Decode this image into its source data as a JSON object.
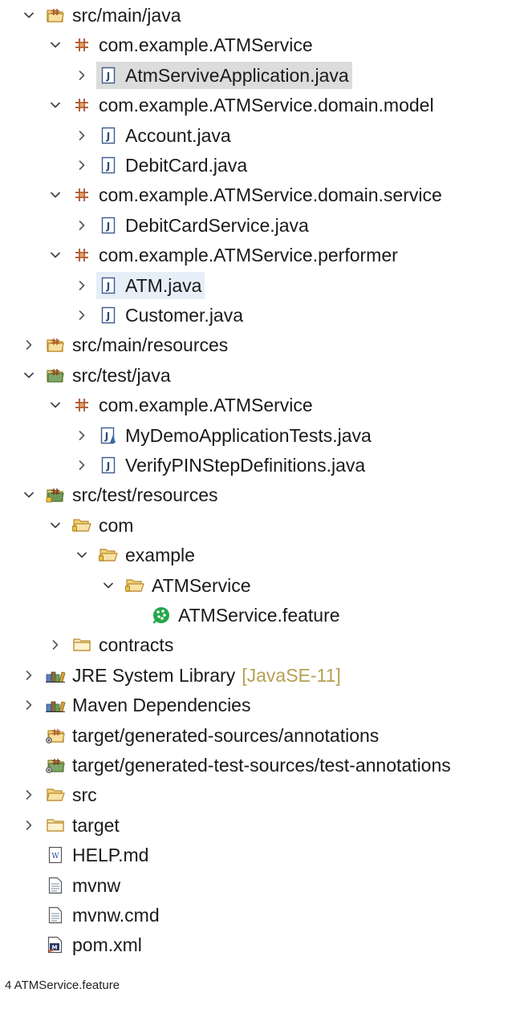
{
  "tree": [
    {
      "label": "src/main/java",
      "indent": 0,
      "chevron": "expanded",
      "icon": "source-folder-icon"
    },
    {
      "label": "com.example.ATMService",
      "indent": 1,
      "chevron": "expanded",
      "icon": "package-icon"
    },
    {
      "label": "AtmServiveApplication.java",
      "indent": 2,
      "chevron": "collapsed",
      "icon": "java-file-icon",
      "state": "selected"
    },
    {
      "label": "com.example.ATMService.domain.model",
      "indent": 1,
      "chevron": "expanded",
      "icon": "package-icon"
    },
    {
      "label": "Account.java",
      "indent": 2,
      "chevron": "collapsed",
      "icon": "java-file-icon"
    },
    {
      "label": "DebitCard.java",
      "indent": 2,
      "chevron": "collapsed",
      "icon": "java-file-icon"
    },
    {
      "label": "com.example.ATMService.domain.service",
      "indent": 1,
      "chevron": "expanded",
      "icon": "package-icon"
    },
    {
      "label": "DebitCardService.java",
      "indent": 2,
      "chevron": "collapsed",
      "icon": "java-file-icon"
    },
    {
      "label": "com.example.ATMService.performer",
      "indent": 1,
      "chevron": "expanded",
      "icon": "package-icon"
    },
    {
      "label": "ATM.java",
      "indent": 2,
      "chevron": "collapsed",
      "icon": "java-file-icon",
      "state": "hover"
    },
    {
      "label": "Customer.java",
      "indent": 2,
      "chevron": "collapsed",
      "icon": "java-file-icon"
    },
    {
      "label": "src/main/resources",
      "indent": 0,
      "chevron": "collapsed",
      "icon": "source-folder-icon"
    },
    {
      "label": "src/test/java",
      "indent": 0,
      "chevron": "expanded",
      "icon": "test-source-folder-icon"
    },
    {
      "label": "com.example.ATMService",
      "indent": 1,
      "chevron": "expanded",
      "icon": "package-icon"
    },
    {
      "label": "MyDemoApplicationTests.java",
      "indent": 2,
      "chevron": "collapsed",
      "icon": "java-test-file-icon"
    },
    {
      "label": "VerifyPINStepDefinitions.java",
      "indent": 2,
      "chevron": "collapsed",
      "icon": "java-file-icon"
    },
    {
      "label": "src/test/resources",
      "indent": 0,
      "chevron": "expanded",
      "icon": "test-resource-folder-icon"
    },
    {
      "label": "com",
      "indent": 1,
      "chevron": "expanded",
      "icon": "open-folder-icon"
    },
    {
      "label": "example",
      "indent": 2,
      "chevron": "expanded",
      "icon": "open-folder-icon"
    },
    {
      "label": "ATMService",
      "indent": 3,
      "chevron": "expanded",
      "icon": "open-folder-icon"
    },
    {
      "label": "ATMService.feature",
      "indent": 4,
      "chevron": "none",
      "icon": "cucumber-feature-icon"
    },
    {
      "label": "contracts",
      "indent": 1,
      "chevron": "collapsed",
      "icon": "closed-folder-icon"
    },
    {
      "label": "JRE System Library",
      "decoration": "[JavaSE-11]",
      "indent": 0,
      "chevron": "collapsed",
      "icon": "library-icon"
    },
    {
      "label": "Maven Dependencies",
      "indent": 0,
      "chevron": "collapsed",
      "icon": "library-icon"
    },
    {
      "label": "target/generated-sources/annotations",
      "indent": 0,
      "chevron": "none",
      "icon": "generated-source-folder-icon"
    },
    {
      "label": "target/generated-test-sources/test-annotations",
      "indent": 0,
      "chevron": "none",
      "icon": "generated-test-folder-icon"
    },
    {
      "label": "src",
      "indent": 0,
      "chevron": "collapsed",
      "icon": "folder-open-icon"
    },
    {
      "label": "target",
      "indent": 0,
      "chevron": "collapsed",
      "icon": "closed-folder-icon"
    },
    {
      "label": "HELP.md",
      "indent": 0,
      "chevron": "none",
      "icon": "markdown-file-icon"
    },
    {
      "label": "mvnw",
      "indent": 0,
      "chevron": "none",
      "icon": "text-file-icon"
    },
    {
      "label": "mvnw.cmd",
      "indent": 0,
      "chevron": "none",
      "icon": "text-file-icon"
    },
    {
      "label": "pom.xml",
      "indent": 0,
      "chevron": "none",
      "icon": "maven-pom-icon"
    }
  ],
  "status_bar": {
    "text": "4 ATMService.feature"
  }
}
